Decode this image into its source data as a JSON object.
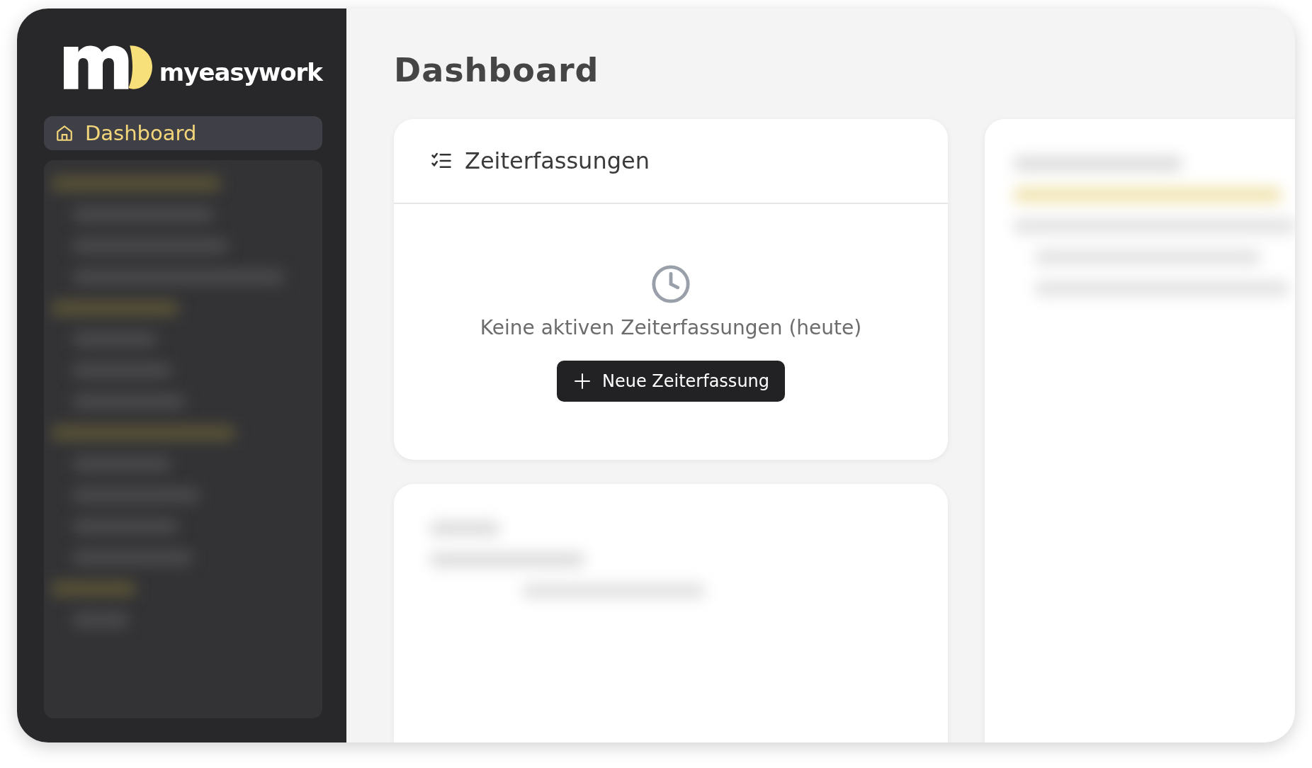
{
  "sidebar": {
    "brand": "myeasywork",
    "items": [
      {
        "label": "Dashboard",
        "selected": true
      }
    ]
  },
  "page": {
    "title": "Dashboard"
  },
  "time_card": {
    "title": "Zeiterfassungen",
    "empty_message": "Keine aktiven Zeiterfassungen (heute)",
    "button": "Neue Zeiterfassung"
  }
}
